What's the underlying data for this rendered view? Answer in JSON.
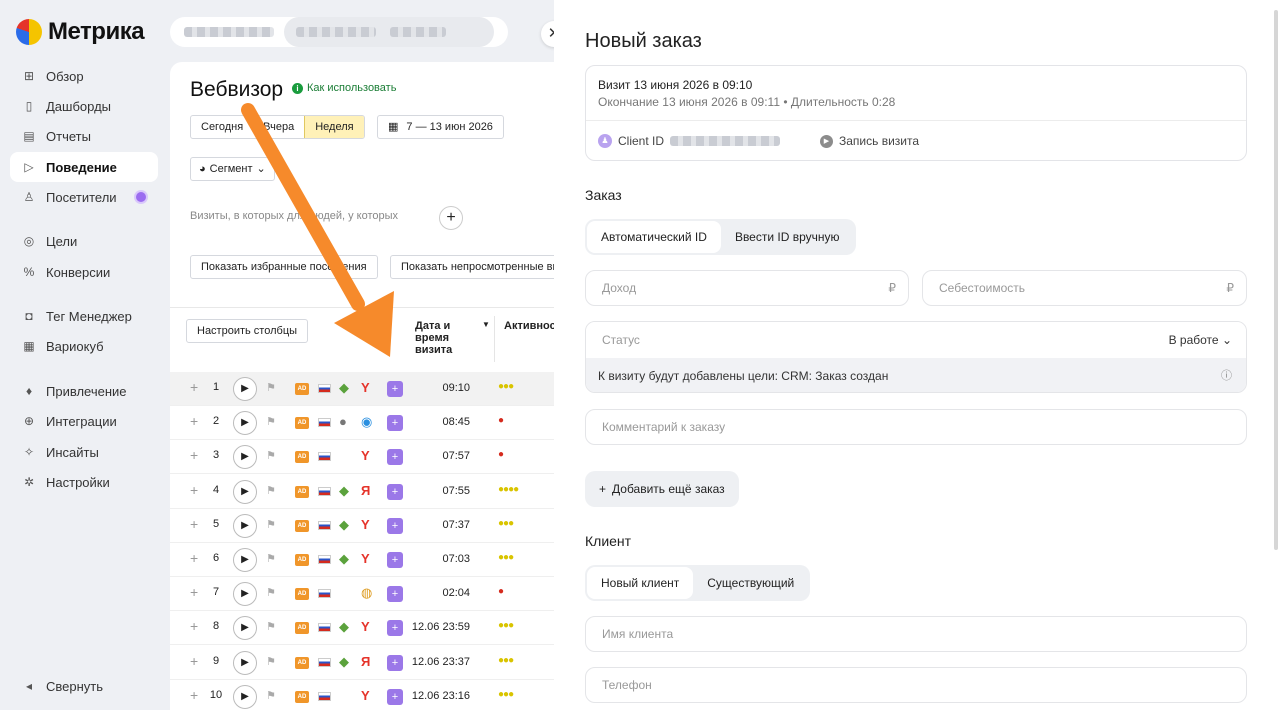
{
  "sidebar": {
    "logo": "Метрика",
    "items": [
      {
        "label": "Обзор",
        "icon": "⊞"
      },
      {
        "label": "Дашборды",
        "icon": "▯"
      },
      {
        "label": "Отчеты",
        "icon": "▤"
      },
      {
        "label": "Поведение",
        "icon": "▷"
      },
      {
        "label": "Посетители",
        "icon": "♙"
      },
      {
        "label": "Цели",
        "icon": "◎"
      },
      {
        "label": "Конверсии",
        "icon": "%"
      },
      {
        "label": "Тег Менеджер",
        "icon": "◘"
      },
      {
        "label": "Вариокуб",
        "icon": "▦"
      },
      {
        "label": "Привлечение",
        "icon": "♦"
      },
      {
        "label": "Интеграции",
        "icon": "⊕"
      },
      {
        "label": "Инсайты",
        "icon": "✧"
      },
      {
        "label": "Настройки",
        "icon": "✲"
      }
    ],
    "collapse": "Свернуть"
  },
  "main": {
    "title": "Вебвизор",
    "howto": "Как использовать",
    "period": [
      "Сегодня",
      "Вчера",
      "Неделя"
    ],
    "date_range": "7 — 13 июн 2026",
    "segment": "Сегмент",
    "filter_text": "Визиты, в которых    для людей, у которых",
    "btn_favorites": "Показать избранные посещения",
    "btn_unwatched": "Показать непросмотренные визиты",
    "btn_columns": "Настроить столбцы",
    "col_date": "Дата и время визита",
    "col_activity": "Активность",
    "rows": [
      {
        "n": "1",
        "time": "09:10",
        "os": "android",
        "browser": "Y",
        "activity": "●●●"
      },
      {
        "n": "2",
        "time": "08:45",
        "os": "apple",
        "browser": "safari",
        "activity": "●"
      },
      {
        "n": "3",
        "time": "07:57",
        "os": "",
        "browser": "Y",
        "activity": "●"
      },
      {
        "n": "4",
        "time": "07:55",
        "os": "android",
        "browser": "Я",
        "activity": "●●●●"
      },
      {
        "n": "5",
        "time": "07:37",
        "os": "android",
        "browser": "Y",
        "activity": "●●●"
      },
      {
        "n": "6",
        "time": "07:03",
        "os": "android",
        "browser": "Y",
        "activity": "●●●"
      },
      {
        "n": "7",
        "time": "02:04",
        "os": "",
        "browser": "chrome",
        "activity": "●"
      },
      {
        "n": "8",
        "time": "12.06 23:59",
        "os": "android",
        "browser": "Y",
        "activity": "●●●"
      },
      {
        "n": "9",
        "time": "12.06 23:37",
        "os": "android",
        "browser": "Я",
        "activity": "●●●"
      },
      {
        "n": "10",
        "time": "12.06 23:16",
        "os": "",
        "browser": "Y",
        "activity": "●●●"
      }
    ]
  },
  "panel": {
    "title": "Новый заказ",
    "visit_title": "Визит 13 июня 2026 в 09:10",
    "visit_sub": "Окончание 13 июня 2026 в 09:11 • Длительность 0:28",
    "client_id": "Client ID",
    "record": "Запись визита",
    "order_title": "Заказ",
    "order_toggle": [
      "Автоматический ID",
      "Ввести ID вручную"
    ],
    "income_placeholder": "Доход",
    "cost_placeholder": "Себестоимость",
    "currency": "₽",
    "status_label": "Статус",
    "status_value": "В работе",
    "status_note": "К визиту будут добавлены цели: CRM: Заказ создан",
    "comment_placeholder": "Комментарий к заказу",
    "add_order": "Добавить ещё заказ",
    "client_title": "Клиент",
    "client_toggle": [
      "Новый клиент",
      "Существующий"
    ],
    "client_name_placeholder": "Имя клиента",
    "phone_placeholder": "Телефон"
  },
  "colors": {
    "accent_orange": "#f68a2b",
    "active_period": "#fff1b8",
    "purple": "#9b78e8"
  }
}
